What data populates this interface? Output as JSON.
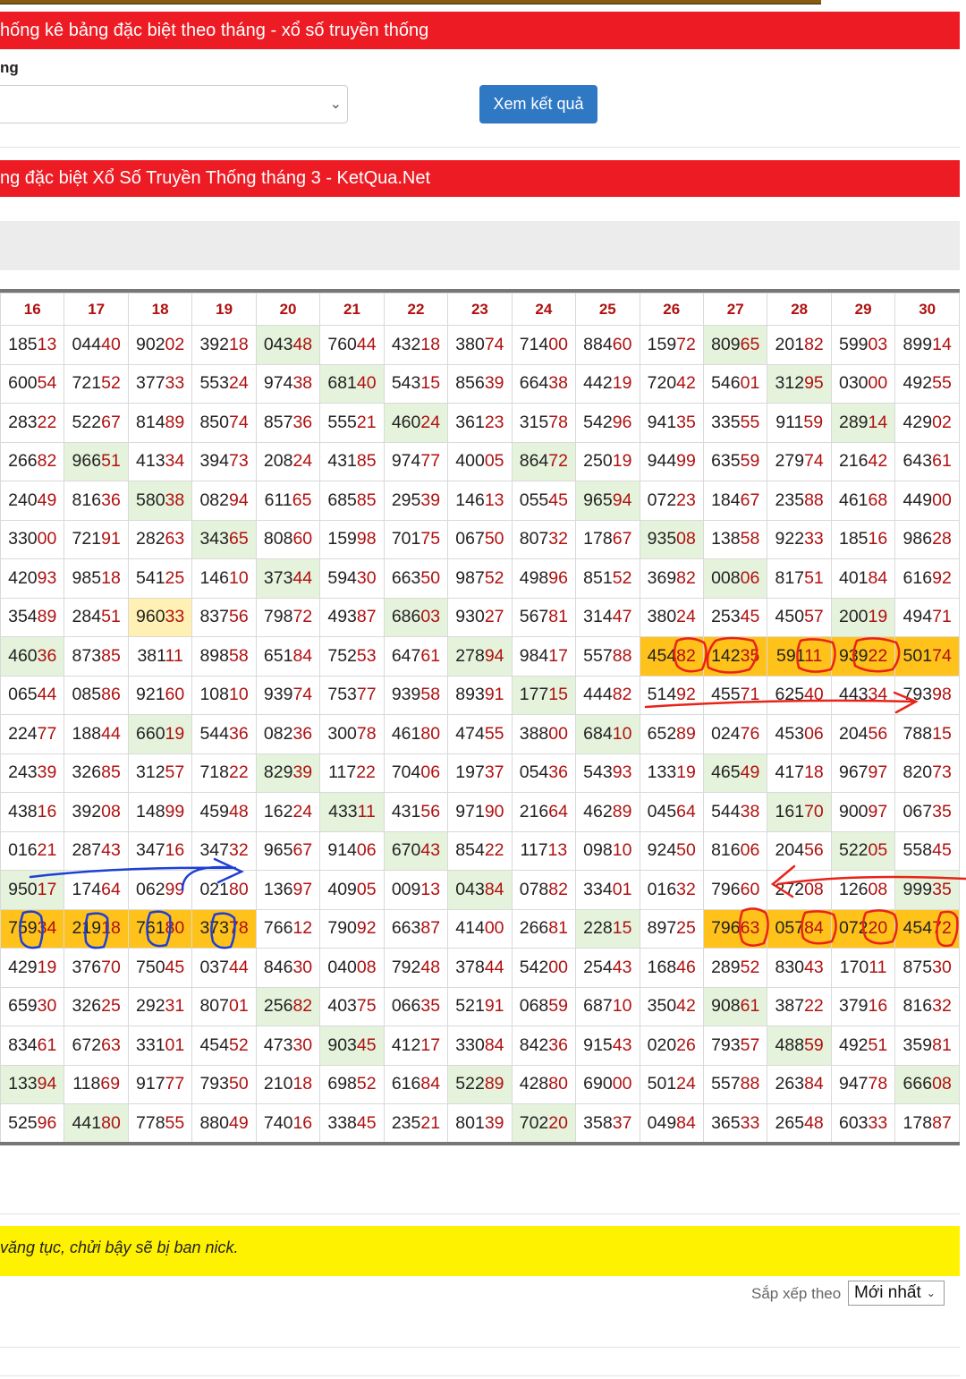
{
  "header": {
    "stats_title": "hống kê bảng đặc biệt theo tháng - xổ số truyền thống",
    "month_label": "ng",
    "view_button": "Xem kết quả",
    "table_title": "ng đặc biệt Xổ Số Truyền Thống tháng 3 - KetQua.Net"
  },
  "table": {
    "columns": [
      "16",
      "17",
      "18",
      "19",
      "20",
      "21",
      "22",
      "23",
      "24",
      "25",
      "26",
      "27",
      "28",
      "29",
      "30"
    ],
    "rows": [
      [
        "18513",
        "04440",
        "90202",
        "39218",
        "04348",
        "76044",
        "43218",
        "38074",
        "71400",
        "88460",
        "15972",
        "80965",
        "20182",
        "59903",
        "89914"
      ],
      [
        "60054",
        "72152",
        "37733",
        "55324",
        "97438",
        "68140",
        "54315",
        "85639",
        "66438",
        "44219",
        "72042",
        "54601",
        "31295",
        "03000",
        "49255"
      ],
      [
        "28322",
        "52267",
        "81489",
        "85074",
        "85736",
        "55521",
        "46024",
        "36123",
        "31578",
        "54296",
        "94135",
        "33555",
        "91159",
        "28914",
        "42902"
      ],
      [
        "26682",
        "96651",
        "41334",
        "39473",
        "20824",
        "43185",
        "97477",
        "40005",
        "86472",
        "25019",
        "94499",
        "63559",
        "27974",
        "21642",
        "64361"
      ],
      [
        "24049",
        "81636",
        "58038",
        "08294",
        "61165",
        "68585",
        "29539",
        "14613",
        "05545",
        "96594",
        "07223",
        "18467",
        "23588",
        "46168",
        "44900"
      ],
      [
        "33000",
        "72191",
        "28263",
        "34365",
        "80860",
        "15998",
        "70175",
        "06750",
        "80732",
        "17867",
        "93508",
        "13858",
        "92233",
        "18516",
        "98628"
      ],
      [
        "42093",
        "98518",
        "54125",
        "14610",
        "37344",
        "59430",
        "66350",
        "98752",
        "49896",
        "85152",
        "36982",
        "00806",
        "81751",
        "40184",
        "61692"
      ],
      [
        "35489",
        "28451",
        "96033",
        "83756",
        "79872",
        "49387",
        "68603",
        "93027",
        "56781",
        "31447",
        "38024",
        "25345",
        "45057",
        "20019",
        "49471"
      ],
      [
        "46036",
        "87385",
        "38111",
        "89858",
        "65184",
        "75253",
        "64761",
        "27894",
        "98417",
        "55788",
        "45482",
        "14235",
        "59111",
        "93922",
        "50174"
      ],
      [
        "06544",
        "08586",
        "92160",
        "10810",
        "93974",
        "75377",
        "93958",
        "89391",
        "17715",
        "44482",
        "51492",
        "45571",
        "62540",
        "44334",
        "79398"
      ],
      [
        "22477",
        "18844",
        "66019",
        "54436",
        "08236",
        "30078",
        "46180",
        "47455",
        "38800",
        "68410",
        "65289",
        "02476",
        "45306",
        "20456",
        "78815"
      ],
      [
        "24339",
        "32685",
        "31257",
        "71822",
        "82939",
        "11722",
        "70406",
        "19737",
        "05436",
        "54393",
        "13319",
        "46549",
        "41718",
        "96797",
        "82073"
      ],
      [
        "43816",
        "39208",
        "14899",
        "45948",
        "16224",
        "43311",
        "43156",
        "97190",
        "21664",
        "46289",
        "04564",
        "54438",
        "16170",
        "90097",
        "06735"
      ],
      [
        "01621",
        "28743",
        "34716",
        "34732",
        "96567",
        "91406",
        "67043",
        "85422",
        "11713",
        "09810",
        "92450",
        "81606",
        "20456",
        "52205",
        "55845"
      ],
      [
        "95017",
        "17464",
        "06299",
        "02180",
        "13697",
        "40905",
        "00913",
        "04384",
        "07882",
        "33401",
        "01632",
        "79660",
        "27208",
        "12608",
        "99935"
      ],
      [
        "75934",
        "21918",
        "76180",
        "37378",
        "76612",
        "79092",
        "66387",
        "41400",
        "26681",
        "22815",
        "89725",
        "79663",
        "05784",
        "07220",
        "45472"
      ],
      [
        "42919",
        "37670",
        "75045",
        "03744",
        "84630",
        "04008",
        "79248",
        "37844",
        "54200",
        "25443",
        "16846",
        "28952",
        "83043",
        "17011",
        "87530"
      ],
      [
        "65930",
        "32625",
        "29231",
        "80701",
        "25682",
        "40375",
        "06635",
        "52191",
        "06859",
        "68710",
        "35042",
        "90861",
        "38722",
        "37916",
        "81632"
      ],
      [
        "83461",
        "67263",
        "33101",
        "45452",
        "47330",
        "90345",
        "41217",
        "33084",
        "84236",
        "91543",
        "02026",
        "79357",
        "48859",
        "49251",
        "35981"
      ],
      [
        "13394",
        "11869",
        "91777",
        "79350",
        "21018",
        "69852",
        "61684",
        "52289",
        "42880",
        "69000",
        "50124",
        "55788",
        "26384",
        "94778",
        "66608"
      ],
      [
        "52596",
        "44180",
        "77855",
        "88049",
        "74016",
        "33845",
        "23521",
        "80139",
        "70220",
        "35837",
        "04984",
        "36533",
        "26548",
        "60333",
        "17887"
      ]
    ],
    "highlight": [
      [
        "",
        "",
        "",
        "",
        "g",
        "",
        "",
        "",
        "",
        "",
        "",
        "g",
        "",
        "",
        ""
      ],
      [
        "",
        "",
        "",
        "",
        "",
        "g",
        "",
        "",
        "",
        "",
        "",
        "",
        "g",
        "",
        ""
      ],
      [
        "",
        "",
        "",
        "",
        "",
        "",
        "g",
        "",
        "",
        "",
        "",
        "",
        "",
        "g",
        ""
      ],
      [
        "",
        "g",
        "",
        "",
        "",
        "",
        "",
        "",
        "g",
        "",
        "",
        "",
        "",
        "",
        ""
      ],
      [
        "",
        "",
        "g",
        "",
        "",
        "",
        "",
        "",
        "",
        "g",
        "",
        "",
        "",
        "",
        ""
      ],
      [
        "",
        "",
        "",
        "g",
        "",
        "",
        "",
        "",
        "",
        "",
        "g",
        "",
        "",
        "",
        ""
      ],
      [
        "",
        "",
        "",
        "",
        "g",
        "",
        "",
        "",
        "",
        "",
        "",
        "g",
        "",
        "",
        ""
      ],
      [
        "",
        "",
        "y",
        "",
        "",
        "",
        "g",
        "",
        "",
        "",
        "",
        "",
        "",
        "g",
        ""
      ],
      [
        "g",
        "",
        "",
        "",
        "",
        "",
        "",
        "g",
        "",
        "",
        "o",
        "o",
        "o",
        "o",
        "o"
      ],
      [
        "",
        "",
        "",
        "",
        "",
        "",
        "",
        "",
        "g",
        "",
        "",
        "",
        "",
        "",
        ""
      ],
      [
        "",
        "",
        "g",
        "",
        "",
        "",
        "",
        "",
        "",
        "g",
        "",
        "",
        "",
        "",
        ""
      ],
      [
        "",
        "",
        "",
        "",
        "g",
        "",
        "",
        "",
        "",
        "",
        "",
        "g",
        "",
        "",
        ""
      ],
      [
        "",
        "",
        "",
        "",
        "",
        "g",
        "",
        "",
        "",
        "",
        "",
        "",
        "g",
        "",
        ""
      ],
      [
        "",
        "",
        "",
        "",
        "",
        "",
        "g",
        "",
        "",
        "",
        "",
        "",
        "",
        "g",
        ""
      ],
      [
        "g",
        "",
        "",
        "",
        "",
        "",
        "",
        "g",
        "",
        "",
        "",
        "",
        "",
        "",
        "g"
      ],
      [
        "o",
        "o",
        "o",
        "o",
        "",
        "",
        "",
        "",
        "",
        "g",
        "",
        "o",
        "o",
        "o",
        "o"
      ],
      [
        "",
        "",
        "",
        "",
        "",
        "",
        "",
        "",
        "",
        "",
        "",
        "",
        "",
        "",
        ""
      ],
      [
        "",
        "",
        "",
        "",
        "g",
        "",
        "",
        "",
        "",
        "",
        "",
        "g",
        "",
        "",
        ""
      ],
      [
        "",
        "",
        "",
        "",
        "",
        "g",
        "",
        "",
        "",
        "",
        "",
        "",
        "g",
        "",
        ""
      ],
      [
        "g",
        "",
        "",
        "",
        "",
        "",
        "",
        "g",
        "",
        "",
        "",
        "",
        "",
        "",
        "g"
      ],
      [
        "",
        "g",
        "",
        "",
        "",
        "",
        "",
        "",
        "g",
        "",
        "",
        "",
        "",
        "",
        ""
      ]
    ]
  },
  "footer": {
    "notice": "văng tục, chửi bậy sẽ bị ban nick.",
    "sort_label": "Sắp xếp theo",
    "sort_value": "Mới nhất"
  },
  "icons": {
    "select_chevron": "chevron-down-icon"
  },
  "colors": {
    "accent_red": "#ed1c24",
    "button_blue": "#2f78c4",
    "highlight_green": "#e5f3dc",
    "highlight_orange": "#ffc21a",
    "notice_yellow": "#fff200"
  }
}
